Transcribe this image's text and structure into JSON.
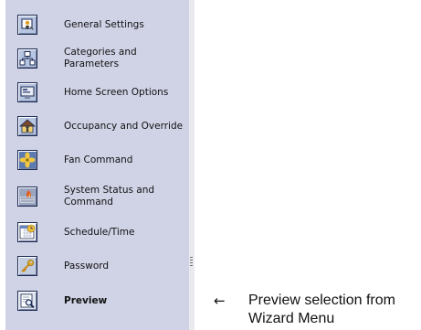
{
  "menu": {
    "items": [
      {
        "label": "General Settings",
        "icon": "general-settings-icon"
      },
      {
        "label": "Categories and Parameters",
        "icon": "categories-parameters-icon"
      },
      {
        "label": "Home Screen Options",
        "icon": "home-screen-options-icon"
      },
      {
        "label": "Occupancy and Override",
        "icon": "occupancy-override-icon"
      },
      {
        "label": "Fan Command",
        "icon": "fan-command-icon"
      },
      {
        "label": "System Status and Command",
        "icon": "system-status-icon"
      },
      {
        "label": "Schedule/Time",
        "icon": "schedule-time-icon"
      },
      {
        "label": "Password",
        "icon": "password-key-icon"
      },
      {
        "label": "Preview",
        "icon": "preview-icon",
        "selected": true
      }
    ]
  },
  "annotation": {
    "arrow": "←",
    "text": "Preview selection from Wizard Menu"
  },
  "colors": {
    "panel": "#d0d3e6",
    "icon_border": "#1c2a52",
    "text": "#111111"
  }
}
